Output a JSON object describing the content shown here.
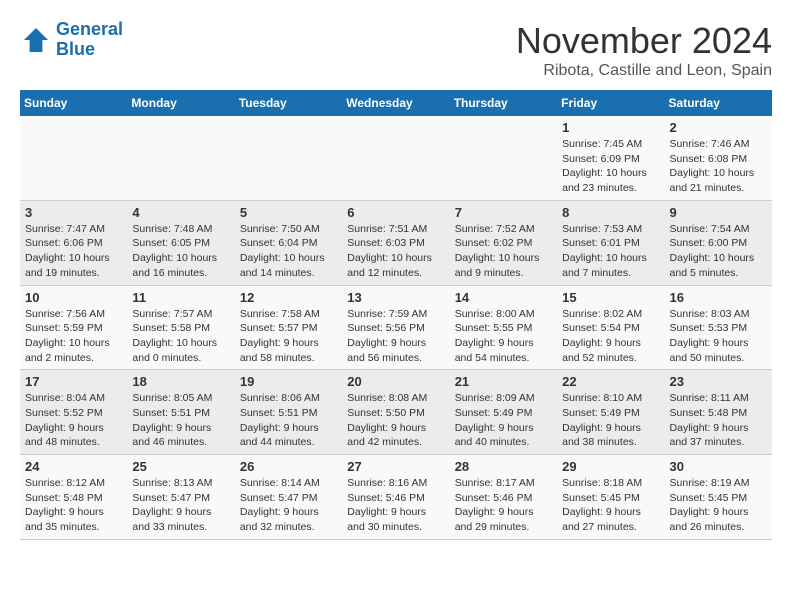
{
  "logo": {
    "text_general": "General",
    "text_blue": "Blue"
  },
  "header": {
    "month_year": "November 2024",
    "location": "Ribota, Castille and Leon, Spain"
  },
  "weekdays": [
    "Sunday",
    "Monday",
    "Tuesday",
    "Wednesday",
    "Thursday",
    "Friday",
    "Saturday"
  ],
  "weeks": [
    [
      {
        "day": "",
        "info": ""
      },
      {
        "day": "",
        "info": ""
      },
      {
        "day": "",
        "info": ""
      },
      {
        "day": "",
        "info": ""
      },
      {
        "day": "",
        "info": ""
      },
      {
        "day": "1",
        "info": "Sunrise: 7:45 AM\nSunset: 6:09 PM\nDaylight: 10 hours and 23 minutes."
      },
      {
        "day": "2",
        "info": "Sunrise: 7:46 AM\nSunset: 6:08 PM\nDaylight: 10 hours and 21 minutes."
      }
    ],
    [
      {
        "day": "3",
        "info": "Sunrise: 7:47 AM\nSunset: 6:06 PM\nDaylight: 10 hours and 19 minutes."
      },
      {
        "day": "4",
        "info": "Sunrise: 7:48 AM\nSunset: 6:05 PM\nDaylight: 10 hours and 16 minutes."
      },
      {
        "day": "5",
        "info": "Sunrise: 7:50 AM\nSunset: 6:04 PM\nDaylight: 10 hours and 14 minutes."
      },
      {
        "day": "6",
        "info": "Sunrise: 7:51 AM\nSunset: 6:03 PM\nDaylight: 10 hours and 12 minutes."
      },
      {
        "day": "7",
        "info": "Sunrise: 7:52 AM\nSunset: 6:02 PM\nDaylight: 10 hours and 9 minutes."
      },
      {
        "day": "8",
        "info": "Sunrise: 7:53 AM\nSunset: 6:01 PM\nDaylight: 10 hours and 7 minutes."
      },
      {
        "day": "9",
        "info": "Sunrise: 7:54 AM\nSunset: 6:00 PM\nDaylight: 10 hours and 5 minutes."
      }
    ],
    [
      {
        "day": "10",
        "info": "Sunrise: 7:56 AM\nSunset: 5:59 PM\nDaylight: 10 hours and 2 minutes."
      },
      {
        "day": "11",
        "info": "Sunrise: 7:57 AM\nSunset: 5:58 PM\nDaylight: 10 hours and 0 minutes."
      },
      {
        "day": "12",
        "info": "Sunrise: 7:58 AM\nSunset: 5:57 PM\nDaylight: 9 hours and 58 minutes."
      },
      {
        "day": "13",
        "info": "Sunrise: 7:59 AM\nSunset: 5:56 PM\nDaylight: 9 hours and 56 minutes."
      },
      {
        "day": "14",
        "info": "Sunrise: 8:00 AM\nSunset: 5:55 PM\nDaylight: 9 hours and 54 minutes."
      },
      {
        "day": "15",
        "info": "Sunrise: 8:02 AM\nSunset: 5:54 PM\nDaylight: 9 hours and 52 minutes."
      },
      {
        "day": "16",
        "info": "Sunrise: 8:03 AM\nSunset: 5:53 PM\nDaylight: 9 hours and 50 minutes."
      }
    ],
    [
      {
        "day": "17",
        "info": "Sunrise: 8:04 AM\nSunset: 5:52 PM\nDaylight: 9 hours and 48 minutes."
      },
      {
        "day": "18",
        "info": "Sunrise: 8:05 AM\nSunset: 5:51 PM\nDaylight: 9 hours and 46 minutes."
      },
      {
        "day": "19",
        "info": "Sunrise: 8:06 AM\nSunset: 5:51 PM\nDaylight: 9 hours and 44 minutes."
      },
      {
        "day": "20",
        "info": "Sunrise: 8:08 AM\nSunset: 5:50 PM\nDaylight: 9 hours and 42 minutes."
      },
      {
        "day": "21",
        "info": "Sunrise: 8:09 AM\nSunset: 5:49 PM\nDaylight: 9 hours and 40 minutes."
      },
      {
        "day": "22",
        "info": "Sunrise: 8:10 AM\nSunset: 5:49 PM\nDaylight: 9 hours and 38 minutes."
      },
      {
        "day": "23",
        "info": "Sunrise: 8:11 AM\nSunset: 5:48 PM\nDaylight: 9 hours and 37 minutes."
      }
    ],
    [
      {
        "day": "24",
        "info": "Sunrise: 8:12 AM\nSunset: 5:48 PM\nDaylight: 9 hours and 35 minutes."
      },
      {
        "day": "25",
        "info": "Sunrise: 8:13 AM\nSunset: 5:47 PM\nDaylight: 9 hours and 33 minutes."
      },
      {
        "day": "26",
        "info": "Sunrise: 8:14 AM\nSunset: 5:47 PM\nDaylight: 9 hours and 32 minutes."
      },
      {
        "day": "27",
        "info": "Sunrise: 8:16 AM\nSunset: 5:46 PM\nDaylight: 9 hours and 30 minutes."
      },
      {
        "day": "28",
        "info": "Sunrise: 8:17 AM\nSunset: 5:46 PM\nDaylight: 9 hours and 29 minutes."
      },
      {
        "day": "29",
        "info": "Sunrise: 8:18 AM\nSunset: 5:45 PM\nDaylight: 9 hours and 27 minutes."
      },
      {
        "day": "30",
        "info": "Sunrise: 8:19 AM\nSunset: 5:45 PM\nDaylight: 9 hours and 26 minutes."
      }
    ]
  ]
}
